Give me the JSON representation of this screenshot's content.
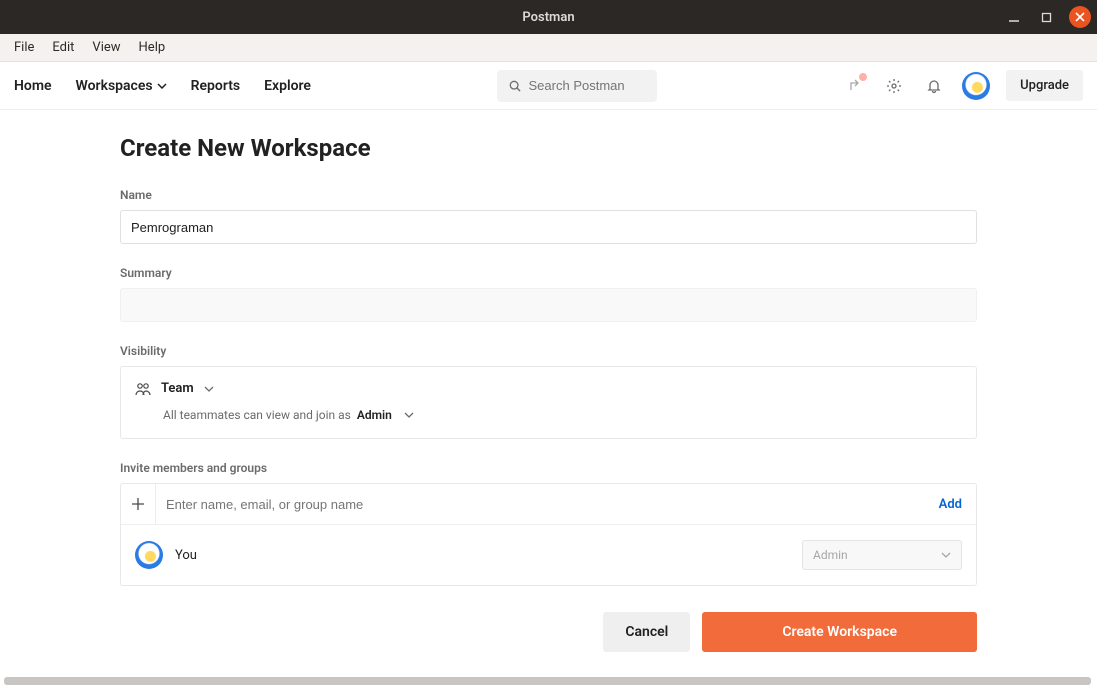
{
  "window": {
    "title": "Postman"
  },
  "menubar": {
    "file": "File",
    "edit": "Edit",
    "view": "View",
    "help": "Help"
  },
  "nav": {
    "home": "Home",
    "workspaces": "Workspaces",
    "reports": "Reports",
    "explore": "Explore"
  },
  "search": {
    "placeholder": "Search Postman"
  },
  "upgrade": "Upgrade",
  "page": {
    "title": "Create New Workspace",
    "name_label": "Name",
    "name_value": "Pemrograman",
    "summary_label": "Summary",
    "visibility_label": "Visibility",
    "visibility_option": "Team",
    "visibility_sub_prefix": "All teammates can view and join as",
    "visibility_role": "Admin",
    "invite_label": "Invite members and groups",
    "invite_placeholder": "Enter name, email, or group name",
    "add_label": "Add",
    "member_you": "You",
    "member_role": "Admin",
    "cancel": "Cancel",
    "create": "Create Workspace"
  }
}
